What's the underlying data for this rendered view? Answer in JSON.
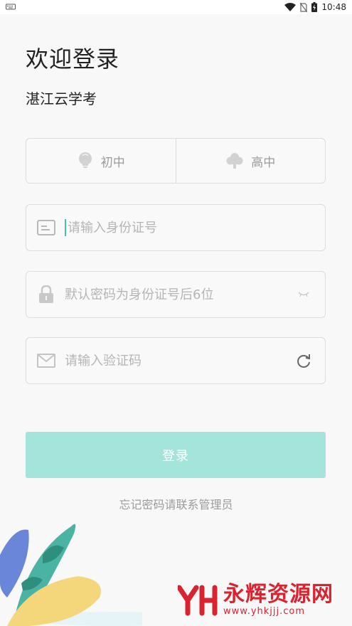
{
  "status_bar": {
    "time": "10:48"
  },
  "welcome_title": "欢迎登录",
  "app_name": "湛江云学考",
  "levels": [
    {
      "label": "初中",
      "icon": "lightbulb-icon"
    },
    {
      "label": "高中",
      "icon": "cloud-icon"
    }
  ],
  "id_field": {
    "placeholder": "请输入身份证号",
    "value": ""
  },
  "password_field": {
    "placeholder": "默认密码为身份证号后6位",
    "value": ""
  },
  "captcha_field": {
    "placeholder": "请输入验证码",
    "value": ""
  },
  "login_label": "登录",
  "forgot_text": "忘记密码请联系管理员",
  "watermark": {
    "brand": "永辉资源网",
    "url": "www.yhkjjj.com"
  },
  "colors": {
    "accent": "#3ec3b0",
    "button": "#a5e4db",
    "watermark": "#d9232f"
  }
}
